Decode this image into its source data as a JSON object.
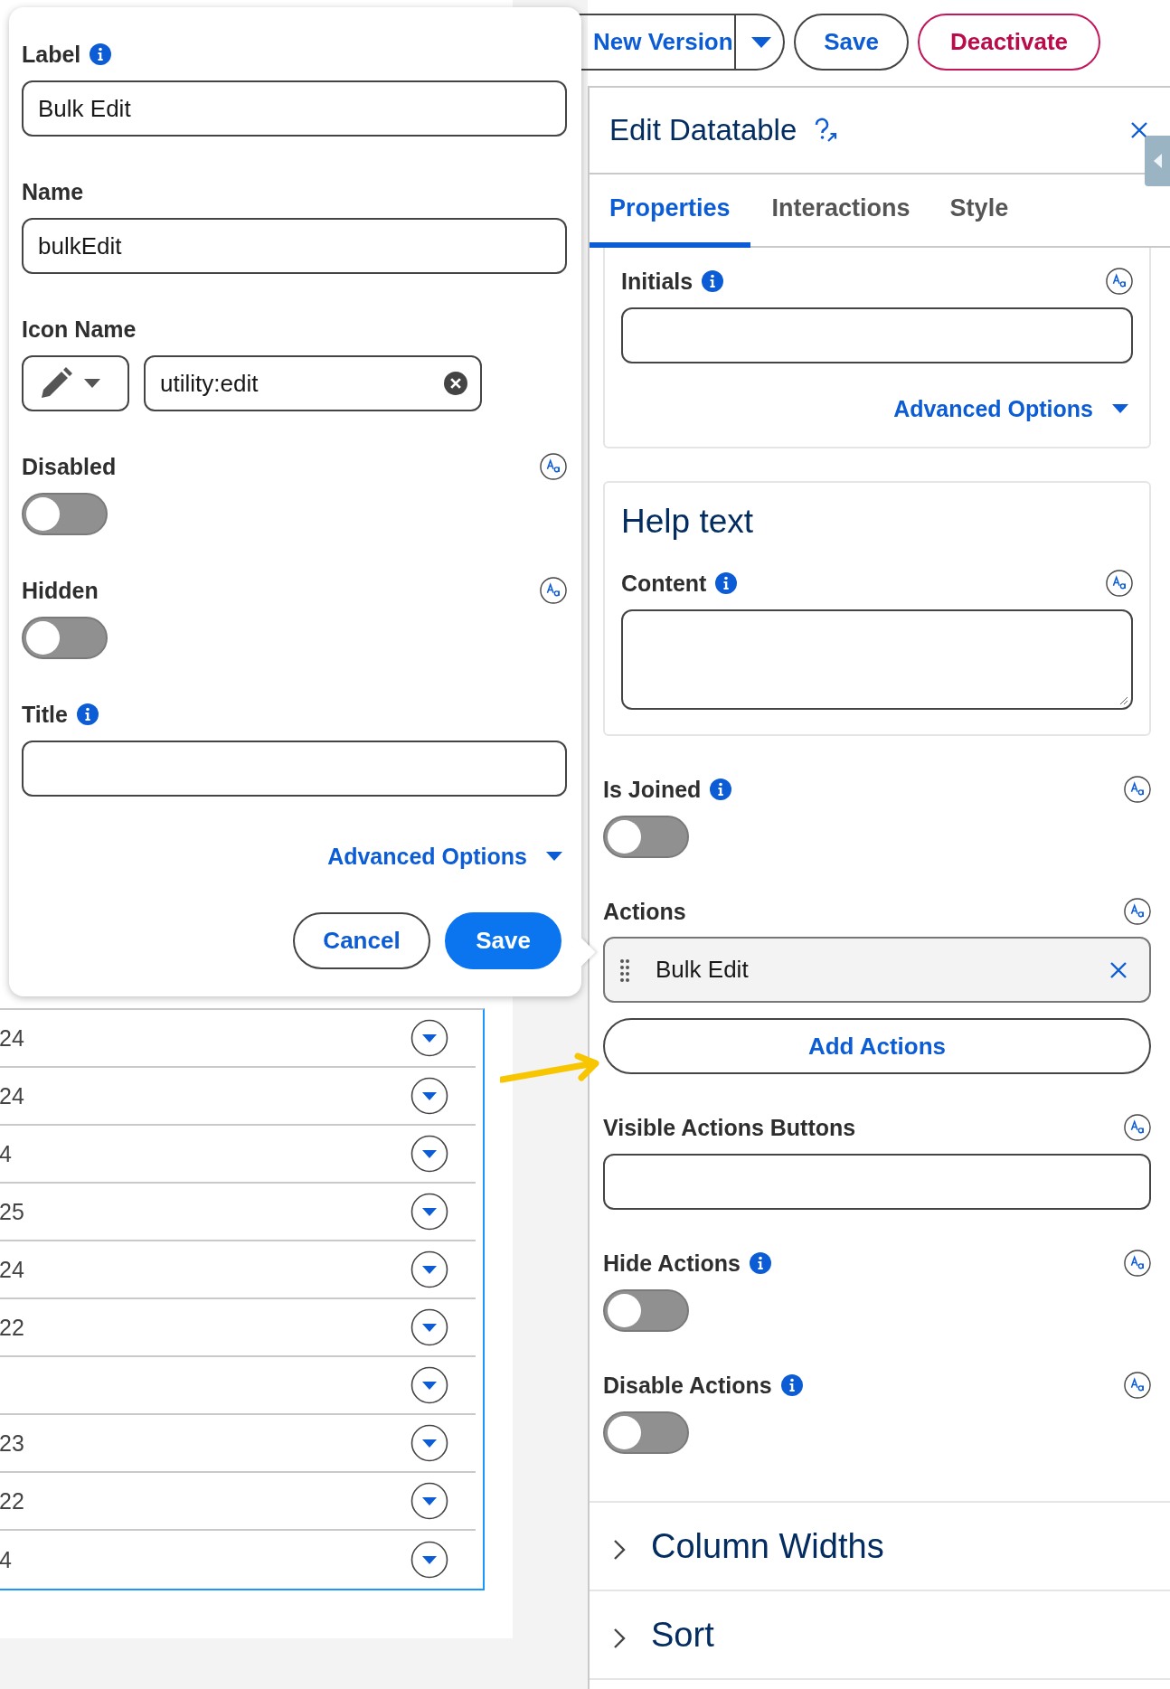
{
  "toolbar": {
    "buttons": [
      {
        "label": "New Version",
        "kind": "split"
      },
      {
        "label": "Save",
        "kind": "outline"
      },
      {
        "label": "Deactivate",
        "kind": "destructive"
      }
    ]
  },
  "table": {
    "rows": [
      {
        "value": "24"
      },
      {
        "value": "24"
      },
      {
        "value": "4"
      },
      {
        "value": "25"
      },
      {
        "value": "24"
      },
      {
        "value": "22"
      },
      {
        "value": null
      },
      {
        "value": "23"
      },
      {
        "value": "22"
      },
      {
        "value": "4"
      }
    ]
  },
  "popover": {
    "fields": [
      {
        "kind": "text",
        "label": "Label",
        "info": true,
        "resource_picker": false,
        "value": "Bulk Edit"
      },
      {
        "kind": "text",
        "label": "Name",
        "info": false,
        "resource_picker": false,
        "value": "bulkEdit"
      },
      {
        "kind": "icon",
        "label": "Icon Name",
        "info": false,
        "resource_picker": false,
        "value": "utility:edit"
      },
      {
        "kind": "toggle",
        "label": "Disabled",
        "info": false,
        "resource_picker": true,
        "on": false
      },
      {
        "kind": "toggle",
        "label": "Hidden",
        "info": false,
        "resource_picker": true,
        "on": false
      },
      {
        "kind": "text",
        "label": "Title",
        "info": true,
        "resource_picker": false
      }
    ],
    "advanced_options": "Advanced Options",
    "buttons": [
      {
        "label": "Cancel",
        "kind": "neutral"
      },
      {
        "label": "Save",
        "kind": "brand"
      }
    ]
  },
  "panel": {
    "title": "Edit Datatable",
    "tabs": [
      {
        "label": "Properties",
        "selected": true
      },
      {
        "label": "Interactions",
        "selected": false
      },
      {
        "label": "Style",
        "selected": false
      }
    ],
    "items": [
      {
        "kind": "card",
        "fields": [
          {
            "kind": "text",
            "label": "Initials",
            "info": true,
            "resource_picker": true
          }
        ],
        "advanced_options": "Advanced Options"
      },
      {
        "kind": "card",
        "heading": "Help text",
        "fields": [
          {
            "kind": "textarea",
            "label": "Content",
            "info": true,
            "resource_picker": true
          }
        ]
      },
      {
        "kind": "toggle",
        "label": "Is Joined",
        "info": true,
        "resource_picker": true,
        "on": false
      },
      {
        "kind": "actions",
        "label": "Actions",
        "info": false,
        "resource_picker": true,
        "actions": [
          {
            "label": "Bulk Edit"
          }
        ],
        "add_button": "Add Actions"
      },
      {
        "kind": "text",
        "label": "Visible Actions Buttons",
        "info": false,
        "resource_picker": true
      },
      {
        "kind": "toggle",
        "label": "Hide Actions",
        "info": true,
        "resource_picker": true,
        "on": false
      },
      {
        "kind": "toggle",
        "label": "Disable Actions",
        "info": true,
        "resource_picker": true,
        "on": false
      }
    ],
    "sections": [
      {
        "title": "Column Widths",
        "expanded": false
      },
      {
        "title": "Sort",
        "expanded": false
      }
    ]
  }
}
